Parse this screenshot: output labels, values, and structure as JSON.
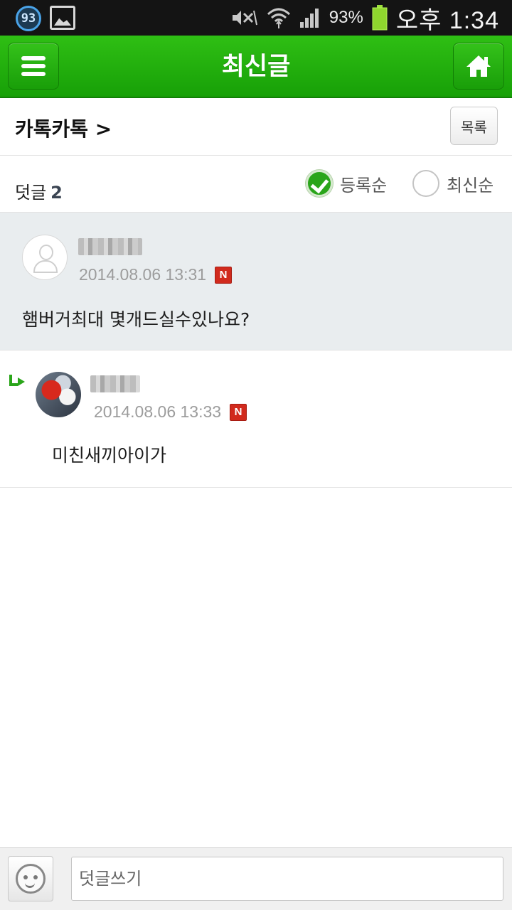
{
  "status_bar": {
    "notification_count": "93",
    "battery_percent": "93%",
    "time": "오후 1:34",
    "icons": [
      "notification-count-icon",
      "gallery-icon",
      "mute-icon",
      "wifi-icon",
      "signal-icon",
      "battery-icon"
    ]
  },
  "app_bar": {
    "title": "최신글",
    "menu_icon": "hamburger-icon",
    "home_icon": "home-icon",
    "accent_color": "#1aa50a"
  },
  "board": {
    "name": "카톡카톡 >",
    "list_button": "목록"
  },
  "comments_header": {
    "label": "덧글",
    "count": "2",
    "sort_options": [
      {
        "label": "등록순",
        "selected": true
      },
      {
        "label": "최신순",
        "selected": false
      }
    ]
  },
  "comments": [
    {
      "date": "2014.08.06 13:31",
      "badge": "N",
      "text": "햄버거최대 몇개드실수있나요?",
      "is_reply": false
    },
    {
      "date": "2014.08.06 13:33",
      "badge": "N",
      "text": "미친새끼아이가",
      "is_reply": true
    }
  ],
  "input_bar": {
    "placeholder": "덧글쓰기",
    "value": "",
    "emoji_icon": "emoticon-icon"
  }
}
